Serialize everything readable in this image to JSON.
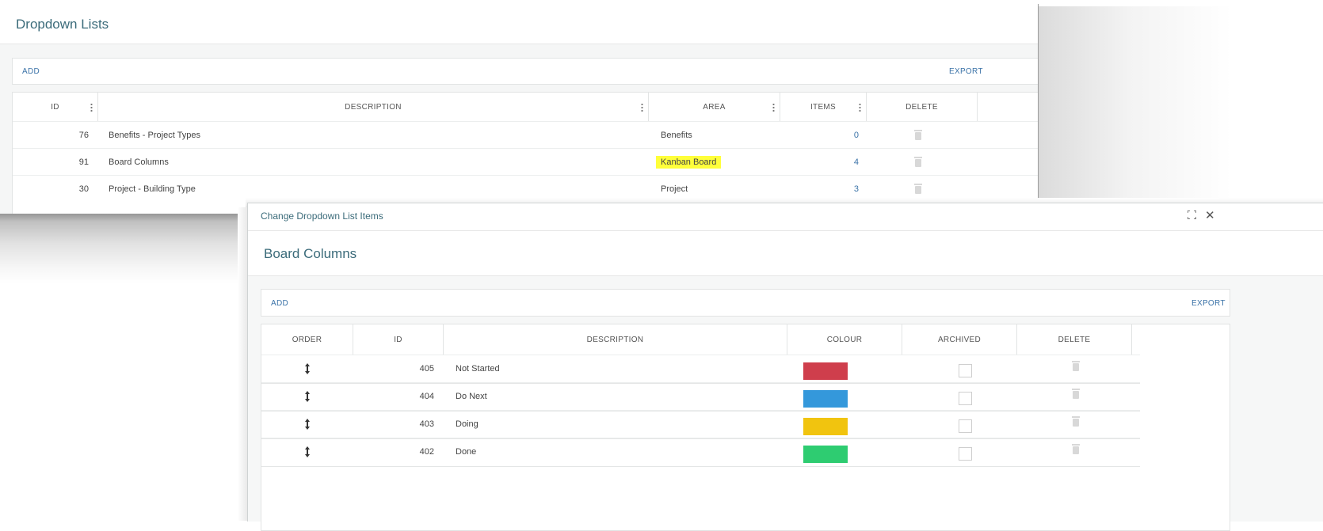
{
  "main_window": {
    "title": "Dropdown Lists",
    "toolbar": {
      "add_label": "ADD",
      "export_label": "EXPORT"
    },
    "columns": [
      "ID",
      "DESCRIPTION",
      "AREA",
      "ITEMS",
      "DELETE"
    ],
    "rows": [
      {
        "id": "76",
        "description": "Benefits - Project Types",
        "area": "Benefits",
        "items": "0"
      },
      {
        "id": "91",
        "description": "Board Columns",
        "area": "Kanban Board",
        "items": "4",
        "highlighted": true
      },
      {
        "id": "30",
        "description": "Project - Building Type",
        "area": "Project",
        "items": "3"
      }
    ]
  },
  "dialog": {
    "title": "Change Dropdown List Items",
    "subtitle": "Board Columns",
    "toolbar": {
      "add_label": "ADD",
      "export_label": "EXPORT"
    },
    "columns": [
      "ORDER",
      "ID",
      "DESCRIPTION",
      "COLOUR",
      "ARCHIVED",
      "DELETE"
    ],
    "rows": [
      {
        "id": "405",
        "description": "Not Started",
        "colour": "#cf3e4c",
        "archived": false
      },
      {
        "id": "404",
        "description": "Do Next",
        "colour": "#3498db",
        "archived": false
      },
      {
        "id": "403",
        "description": "Doing",
        "colour": "#f1c40f",
        "archived": false
      },
      {
        "id": "402",
        "description": "Done",
        "colour": "#2ecc71",
        "archived": false
      }
    ],
    "icons": {
      "order": "drag-handle-icon",
      "expand": "expand-icon",
      "close": "close-icon",
      "delete": "trash-icon"
    }
  },
  "colors": {
    "accent_text": "#3b6b7a",
    "link": "#3b73a8",
    "highlight": "#ffff3a"
  }
}
